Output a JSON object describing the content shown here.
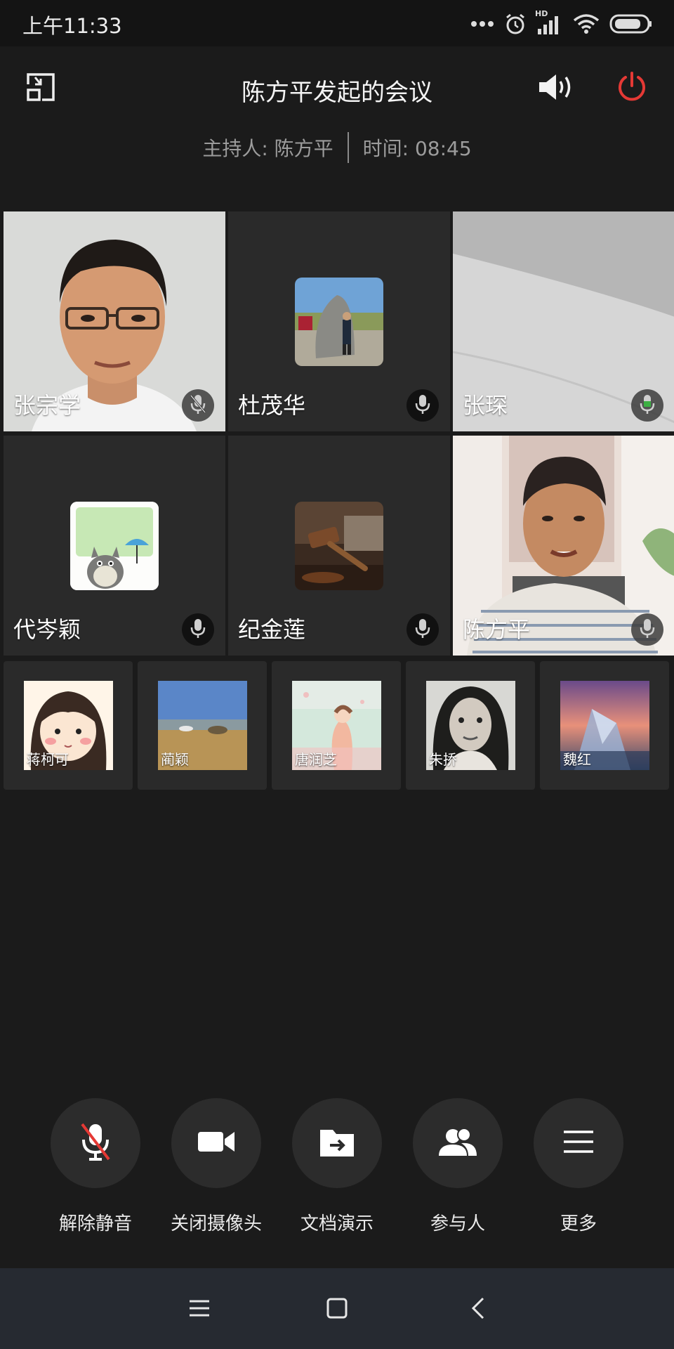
{
  "status_bar": {
    "time": "上午11:33",
    "network_label": "HD",
    "icons": [
      "more-dots-icon",
      "alarm-icon",
      "hd-signal-icon",
      "wifi-icon",
      "battery-icon"
    ]
  },
  "header": {
    "title": "陈方平发起的会议",
    "host_label": "主持人: 陈方平",
    "time_label": "时间: 08:45",
    "icons": [
      "float-window-icon",
      "speaker-icon",
      "power-icon"
    ],
    "accent_color": "#e53935"
  },
  "video_tiles": [
    {
      "name": "张宗学",
      "type": "video",
      "mic": "muted"
    },
    {
      "name": "杜茂华",
      "type": "avatar",
      "mic": "idle"
    },
    {
      "name": "张琛",
      "type": "video",
      "mic": "speaking"
    },
    {
      "name": "代岑颖",
      "type": "avatar",
      "mic": "idle"
    },
    {
      "name": "纪金莲",
      "type": "avatar",
      "mic": "idle"
    },
    {
      "name": "陈方平",
      "type": "video",
      "mic": "idle"
    }
  ],
  "thumbnails": [
    {
      "name": "蒋柯可"
    },
    {
      "name": "蔺颖"
    },
    {
      "name": "唐润芝"
    },
    {
      "name": "朱挢"
    },
    {
      "name": "魏红"
    }
  ],
  "controls": [
    {
      "label": "解除静音",
      "icon": "mic-muted-icon"
    },
    {
      "label": "关闭摄像头",
      "icon": "camera-icon"
    },
    {
      "label": "文档演示",
      "icon": "share-doc-icon"
    },
    {
      "label": "参与人",
      "icon": "participants-icon"
    },
    {
      "label": "更多",
      "icon": "menu-icon"
    }
  ],
  "nav": {
    "icons": [
      "nav-menu-icon",
      "nav-home-icon",
      "nav-back-icon"
    ],
    "background": "#262a31"
  },
  "colors": {
    "background": "#1b1b1b",
    "speaking_mic": "#3cb043",
    "muted_slash": "#e53935"
  }
}
